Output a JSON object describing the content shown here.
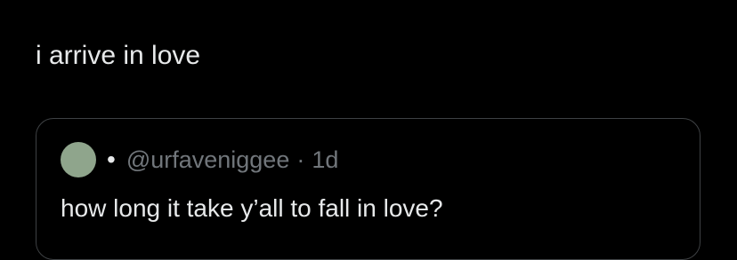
{
  "post": {
    "text": "i arrive in love"
  },
  "quote": {
    "bullet": "•",
    "handle": "@urfaveniggee",
    "separator": "·",
    "time": "1d",
    "text": "how long it take y’all to fall in love?"
  },
  "colors": {
    "background": "#000000",
    "text_primary": "#e7e9ea",
    "text_secondary": "#71767b",
    "border": "#3e4144",
    "avatar": "#8fa58c"
  }
}
